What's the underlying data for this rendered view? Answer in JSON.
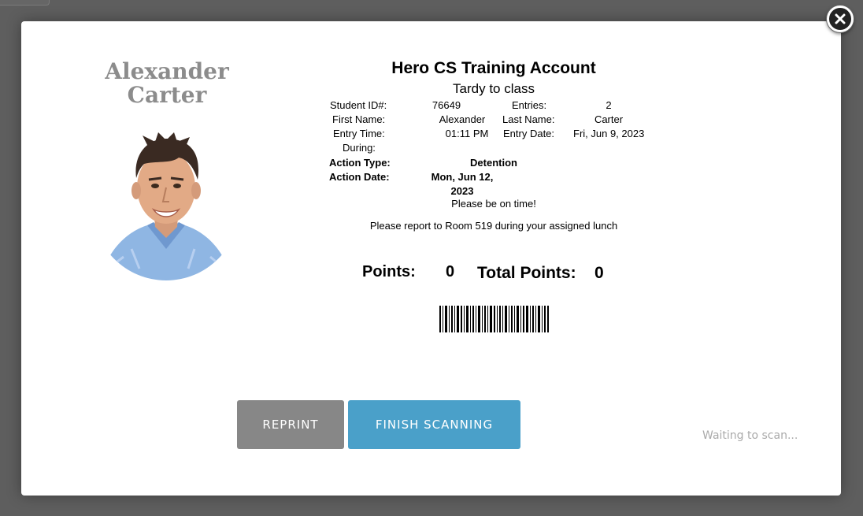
{
  "student": {
    "name_line1": "Alexander",
    "name_line2": "Carter"
  },
  "card": {
    "title": "Hero CS Training Account",
    "subtitle": "Tardy to class",
    "labels": {
      "student_id": "Student ID#:",
      "entries": "Entries:",
      "first_name": "First Name:",
      "last_name": "Last Name:",
      "entry_time": "Entry Time:",
      "entry_date": "Entry Date:",
      "during": "During:",
      "action_type": "Action Type:",
      "action_date": "Action Date:"
    },
    "values": {
      "student_id": "76649",
      "entries": "2",
      "first_name": "Alexander",
      "last_name": "Carter",
      "entry_time": "01:11 PM",
      "entry_date": "Fri, Jun 9, 2023",
      "during": "",
      "action_type": "Detention",
      "action_date_line1": "Mon, Jun 12,",
      "action_date_line2": "2023"
    },
    "message1": "Please be on time!",
    "message2": "Please report to Room 519 during your assigned lunch",
    "points_label": "Points:",
    "points_value": "0",
    "total_points_label": "Total Points:",
    "total_points_value": "0"
  },
  "buttons": {
    "reprint": "REPRINT",
    "finish": "FINISH SCANNING"
  },
  "status": "Waiting to scan...",
  "colors": {
    "overlay": "#5e5e5e",
    "reprint_bg": "#878787",
    "finish_bg": "#4aa0c9",
    "name_color": "#8c8c8c",
    "status_color": "#aaaaaa"
  },
  "icons": {
    "close": "close-icon",
    "photo": "student-photo"
  }
}
